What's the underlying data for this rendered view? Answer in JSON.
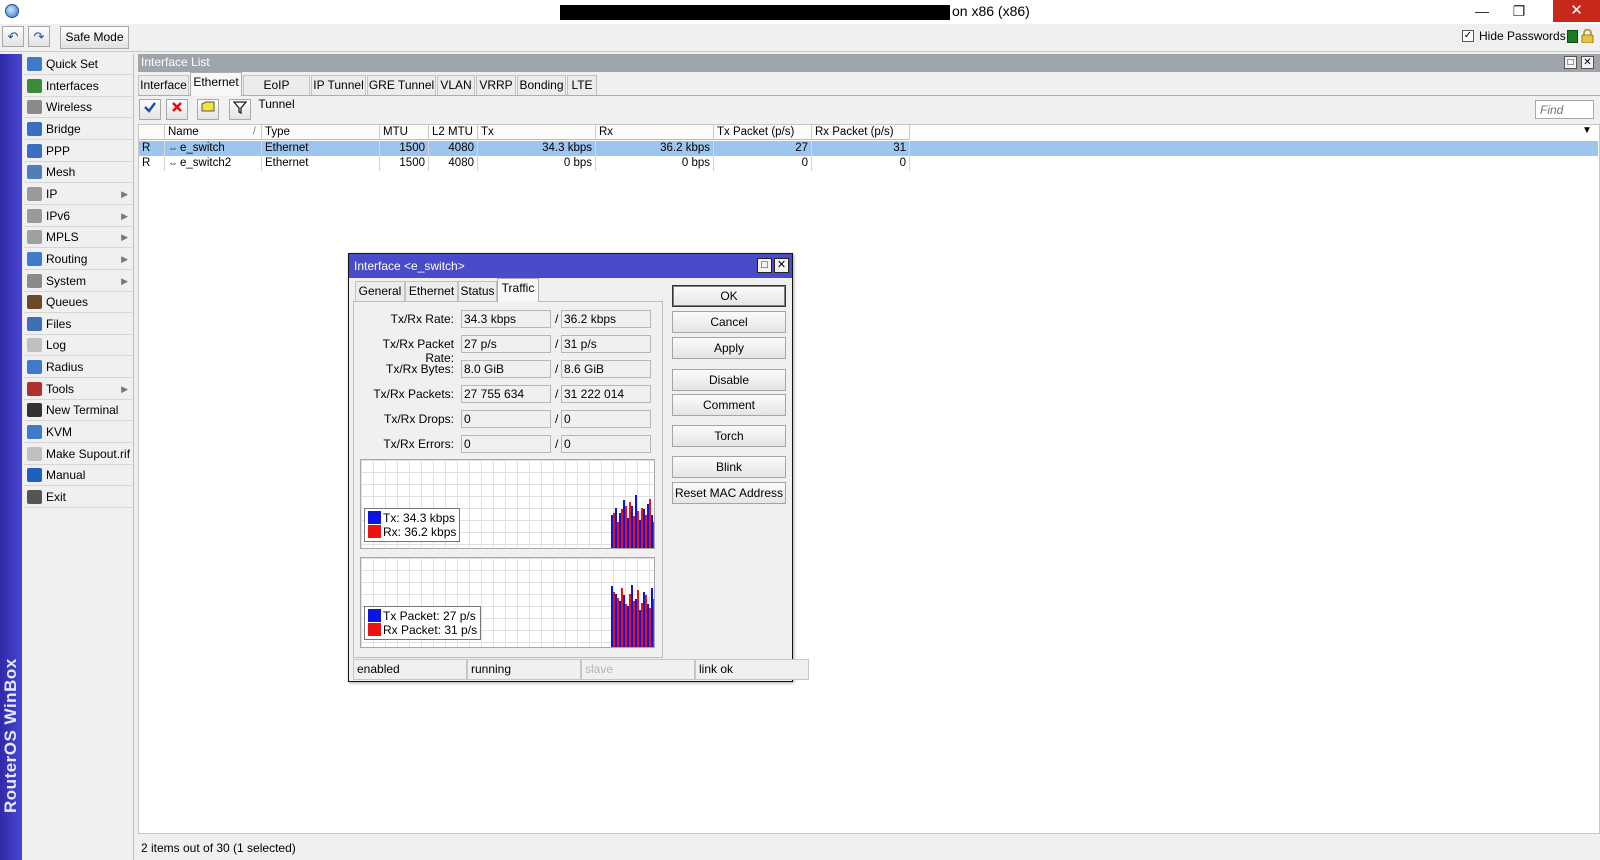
{
  "window": {
    "title_suffix": "on x86 (x86)",
    "minimize_glyph": "—",
    "restore_glyph": "❐",
    "close_glyph": "✕"
  },
  "toolbar": {
    "undo_glyph": "↶",
    "redo_glyph": "↷",
    "safe_mode_label": "Safe Mode",
    "hide_passwords_label": "Hide Passwords",
    "hide_passwords_checked": "✓"
  },
  "brand": "RouterOS WinBox",
  "sidebar": {
    "items": [
      {
        "label": "Quick Set",
        "icon": "quickset-icon",
        "color": "#3e7cc9"
      },
      {
        "label": "Interfaces",
        "icon": "interfaces-icon",
        "color": "#3c8a3c"
      },
      {
        "label": "Wireless",
        "icon": "wireless-icon",
        "color": "#8a8a8a"
      },
      {
        "label": "Bridge",
        "icon": "bridge-icon",
        "color": "#3a6fc2"
      },
      {
        "label": "PPP",
        "icon": "ppp-icon",
        "color": "#3a6fc2"
      },
      {
        "label": "Mesh",
        "icon": "mesh-icon",
        "color": "#4f7fb8"
      },
      {
        "label": "IP",
        "icon": "ip-icon",
        "color": "#9a9a9a"
      },
      {
        "label": "IPv6",
        "icon": "ipv6-icon",
        "color": "#9a9a9a"
      },
      {
        "label": "MPLS",
        "icon": "mpls-icon",
        "color": "#a0a0a0"
      },
      {
        "label": "Routing",
        "icon": "routing-icon",
        "color": "#3e7cc9"
      },
      {
        "label": "System",
        "icon": "system-icon",
        "color": "#8a8a8a"
      },
      {
        "label": "Queues",
        "icon": "queues-icon",
        "color": "#6b4a2b"
      },
      {
        "label": "Files",
        "icon": "files-icon",
        "color": "#3d6fb4"
      },
      {
        "label": "Log",
        "icon": "log-icon",
        "color": "#c0c0c0"
      },
      {
        "label": "Radius",
        "icon": "radius-icon",
        "color": "#3e7cc9"
      },
      {
        "label": "Tools",
        "icon": "tools-icon",
        "color": "#b03030"
      },
      {
        "label": "New Terminal",
        "icon": "terminal-icon",
        "color": "#333333"
      },
      {
        "label": "KVM",
        "icon": "kvm-icon",
        "color": "#3e7cc9"
      },
      {
        "label": "Make Supout.rif",
        "icon": "supout-icon",
        "color": "#c0c0c0"
      },
      {
        "label": "Manual",
        "icon": "manual-icon",
        "color": "#1f5fbf"
      },
      {
        "label": "Exit",
        "icon": "exit-icon",
        "color": "#555555"
      }
    ],
    "arrow": "▶"
  },
  "interface_list": {
    "title": "Interface List",
    "tabs": [
      "Interface",
      "Ethernet",
      "EoIP Tunnel",
      "IP Tunnel",
      "GRE Tunnel",
      "VLAN",
      "VRRP",
      "Bonding",
      "LTE"
    ],
    "active_tab": "Ethernet",
    "find_placeholder": "Find",
    "columns": [
      "",
      "Name",
      "Type",
      "MTU",
      "L2 MTU",
      "Tx",
      "Rx",
      "Tx Packet (p/s)",
      "Rx Packet (p/s)"
    ],
    "sort_glyph": "/",
    "menu_glyph": "▼",
    "rows": [
      {
        "flag": "R",
        "name": "e_switch",
        "type": "Ethernet",
        "mtu": "1500",
        "l2mtu": "4080",
        "tx": "34.3 kbps",
        "rx": "36.2 kbps",
        "txp": "27",
        "rxp": "31",
        "selected": true
      },
      {
        "flag": "R",
        "name": "e_switch2",
        "type": "Ethernet",
        "mtu": "1500",
        "l2mtu": "4080",
        "tx": "0 bps",
        "rx": "0 bps",
        "txp": "0",
        "rxp": "0",
        "selected": false
      }
    ],
    "status": "2 items out of 30 (1 selected)"
  },
  "dialog": {
    "title": "Interface <e_switch>",
    "tabs": [
      "General",
      "Ethernet",
      "Status",
      "Traffic"
    ],
    "active_tab": "Traffic",
    "fields": [
      {
        "label": "Tx/Rx Rate:",
        "tx": "34.3 kbps",
        "rx": "36.2 kbps"
      },
      {
        "label": "Tx/Rx Packet Rate:",
        "tx": "27 p/s",
        "rx": "31 p/s"
      },
      {
        "label": "Tx/Rx Bytes:",
        "tx": "8.0 GiB",
        "rx": "8.6 GiB"
      },
      {
        "label": "Tx/Rx Packets:",
        "tx": "27 755 634",
        "rx": "31 222 014"
      },
      {
        "label": "Tx/Rx Drops:",
        "tx": "0",
        "rx": "0"
      },
      {
        "label": "Tx/Rx Errors:",
        "tx": "0",
        "rx": "0"
      }
    ],
    "slash": "/",
    "graph1": {
      "tx_label": "Tx:",
      "tx_value": "34.3 kbps",
      "rx_label": "Rx:",
      "rx_value": "36.2 kbps"
    },
    "graph2": {
      "tx_label": "Tx Packet:",
      "tx_value": "27 p/s",
      "rx_label": "Rx Packet:",
      "rx_value": "31 p/s"
    },
    "colors": {
      "tx": "#0a16e0",
      "rx": "#ee1111"
    },
    "buttons": [
      "OK",
      "Cancel",
      "Apply",
      "Disable",
      "Comment",
      "Torch",
      "Blink",
      "Reset MAC Address"
    ],
    "status": [
      "enabled",
      "running",
      "slave",
      "link ok"
    ]
  }
}
